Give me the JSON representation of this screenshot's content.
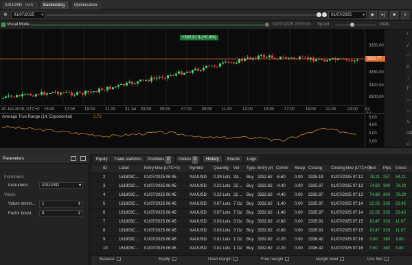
{
  "tabs": {
    "symbol_tab": "XAUUSD",
    "timeframe": "m15",
    "backtesting": "Backtesting",
    "optimisation": "Optimisation"
  },
  "toolbar": {
    "start_date": "01/07/2025",
    "end_date": "01/07/2025"
  },
  "visual_mode": {
    "label": "Visual Mode",
    "timestamp": "01/07/2025 23:59:00",
    "speed_label": "Speed:",
    "speed_value": "10/2s"
  },
  "chart": {
    "badge": "+300.81 $ (+0.4%)",
    "price_tag": "3326.77",
    "price_levels": [
      "3350.00",
      "3340.00",
      "3330.00",
      "3320.00",
      "3310.00",
      "3300.00"
    ],
    "time_labels": [
      "30 Jun 2025, UTC+0",
      "15:00",
      "17:00",
      "19:00",
      "21:00",
      "31 Jul",
      "03:00",
      "05:00",
      "07:00",
      "09:00",
      "11:00",
      "13:00",
      "15:00",
      "17:00",
      "19:00",
      "21:00",
      "23:00",
      "02 Jul 2025"
    ],
    "indicator_label": "Average True Range (14, Exponential)",
    "indicator_value": "2.72",
    "indicator_levels": [
      "5.00",
      "4.00",
      "3.00",
      "2.00"
    ]
  },
  "params": {
    "title": "Parameters",
    "group_instrument": "Instrument",
    "instrument_label": "Instrument",
    "instrument_value": "XAUUSD",
    "group_volume": "Volum",
    "vol_min_label": "Volum minim...",
    "vol_min_value": "1",
    "factor_label": "Factor boost",
    "factor_value": "9"
  },
  "bottom_tabs": {
    "equity": "Equity",
    "trade_stats": "Trade statistics",
    "positions": "Positions",
    "positions_count": "0",
    "orders": "Orders",
    "orders_count": "0",
    "history": "History",
    "events": "Events",
    "logs": "Logs"
  },
  "history": {
    "columns": [
      "ID",
      "Label",
      "Entry time (UTC+0)",
      "Symbol",
      "Quantity",
      "Vol",
      "Type",
      "Entry pri",
      "Comm",
      "Swap",
      "Closing",
      "Closing time (UTC+0)",
      "Net",
      "Pips",
      "Gross"
    ],
    "rows": [
      [
        "2",
        "161803C...",
        "01/07/2025 06:45",
        "XAUUSD",
        "0.39 Lots",
        "33...",
        "Buy",
        "3332.62",
        "-6.60",
        "0.00",
        "3335.19",
        "01/07/2025 07:12",
        "78.21",
        "257",
        "84.21"
      ],
      [
        "3",
        "161803C...",
        "01/07/2025 06:45",
        "XAUUSD",
        "0.22 Lots",
        "22 ...",
        "Buy",
        "3332.62",
        "-4.40",
        "0.00",
        "3335.97",
        "01/07/2025 07:13",
        "74.89",
        "300",
        "79.29"
      ],
      [
        "4",
        "161803C...",
        "01/07/2025 06:45",
        "XAUUSD",
        "0.22 Lots",
        "22 ...",
        "Buy",
        "3332.62",
        "-4.40",
        "0.00",
        "3335.97",
        "01/07/2025 07:13",
        "74.89",
        "300",
        "79.29"
      ],
      [
        "5",
        "161803C...",
        "01/07/2025 06:45",
        "XAUUSD",
        "0.07 Lots",
        "7 Oz",
        "Buy",
        "3332.62",
        "-1.40",
        "0.00",
        "3335.97",
        "01/07/2025 07:14",
        "22.05",
        "335",
        "23.45"
      ],
      [
        "6",
        "161803C...",
        "01/07/2025 06:45",
        "XAUUSD",
        "0.07 Lots",
        "7 Oz",
        "Buy",
        "3332.62",
        "-1.40",
        "0.00",
        "3335.97",
        "01/07/2025 07:14",
        "22.05",
        "335",
        "23.45"
      ],
      [
        "7",
        "161803C...",
        "01/07/2025 06:45",
        "XAUUSD",
        "0.03 Lots",
        "3 Oz",
        "Buy",
        "3332.62",
        "-0.60",
        "0.00",
        "3335.91",
        "01/07/2025 07:15",
        "10.47",
        "329",
        "11.07"
      ],
      [
        "8",
        "161803C...",
        "01/07/2025 06:45",
        "XAUUSD",
        "0.03 Lots",
        "3 Oz",
        "Buy",
        "3332.62",
        "-0.60",
        "0.00",
        "3335.91",
        "01/07/2025 07:15",
        "10.47",
        "329",
        "11.07"
      ],
      [
        "9",
        "161803C...",
        "01/07/2025 06:45",
        "XAUUSD",
        "0.01 Lots",
        "1 Oz",
        "Buy",
        "3332.62",
        "-0.20",
        "0.00",
        "3336.42",
        "01/07/2025 07:16",
        "3.60",
        "380",
        "3.80"
      ],
      [
        "10",
        "161803C...",
        "01/07/2025 06:45",
        "XAUUSD",
        "0.01 Lots",
        "1 Oz",
        "Buy",
        "3332.62",
        "-0.20",
        "0.00",
        "3336.42",
        "01/07/2025 07:16",
        "3.60",
        "380",
        "3.80"
      ]
    ]
  },
  "footer": {
    "balance": "Balance",
    "equity": "Equity",
    "used_margin": "Used margin",
    "free_margin": "Free margin",
    "margin_level": "Margin level",
    "unr_net": "Unr. Net"
  },
  "colors": {
    "up": "#4cd26e",
    "down": "#e04040",
    "price_line": "#e07030",
    "atr": "#d08a2a",
    "accent": "#33aa55"
  }
}
